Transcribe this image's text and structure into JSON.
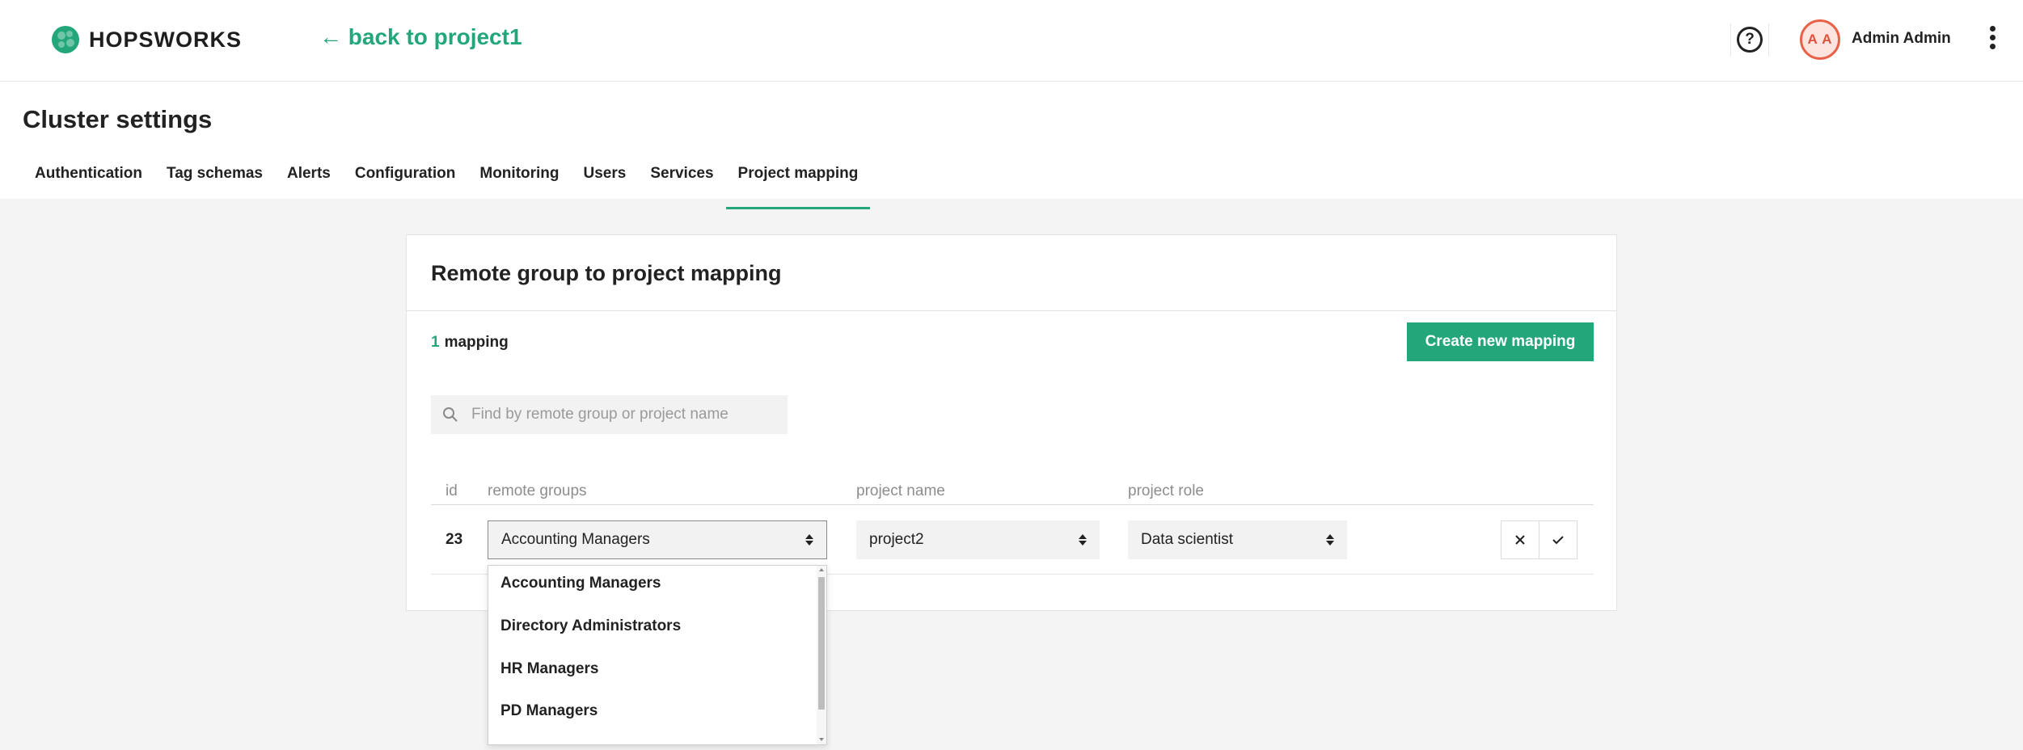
{
  "brand": {
    "name": "HOPSWORKS",
    "accent_color": "#23a77a"
  },
  "nav": {
    "back_link": "← back to project1"
  },
  "user": {
    "initials": "A A",
    "name": "Admin Admin",
    "help_icon": "question-circle-icon",
    "menu_icon": "kebab-menu-icon"
  },
  "page": {
    "title": "Cluster settings"
  },
  "tabs": [
    {
      "label": "Authentication"
    },
    {
      "label": "Tag schemas"
    },
    {
      "label": "Alerts"
    },
    {
      "label": "Configuration"
    },
    {
      "label": "Monitoring"
    },
    {
      "label": "Users"
    },
    {
      "label": "Services"
    },
    {
      "label": "Project mapping",
      "active": true
    }
  ],
  "card": {
    "title": "Remote group to project mapping",
    "count": "1",
    "count_label": "mapping",
    "create_button": "Create new mapping",
    "search_placeholder": "Find by remote group or project name"
  },
  "table": {
    "columns": [
      "id",
      "remote groups",
      "project name",
      "project role"
    ],
    "rows": [
      {
        "id": "23",
        "remote_group": "Accounting Managers",
        "project_name": "project2",
        "project_role": "Data scientist"
      }
    ]
  },
  "dropdown": {
    "options": [
      "Accounting Managers",
      "Directory Administrators",
      "HR Managers",
      "PD Managers"
    ]
  }
}
